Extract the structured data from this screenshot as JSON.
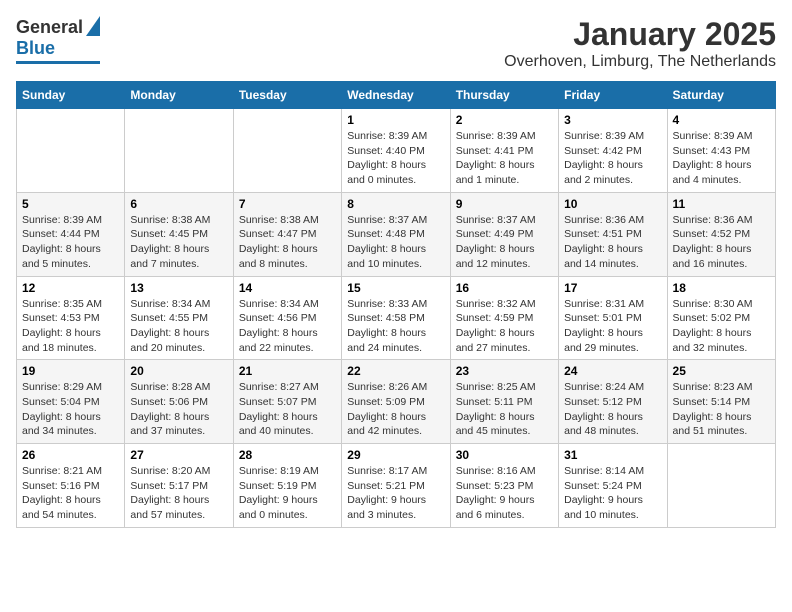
{
  "logo": {
    "general": "General",
    "blue": "Blue"
  },
  "title": "January 2025",
  "subtitle": "Overhoven, Limburg, The Netherlands",
  "days_of_week": [
    "Sunday",
    "Monday",
    "Tuesday",
    "Wednesday",
    "Thursday",
    "Friday",
    "Saturday"
  ],
  "weeks": [
    [
      {
        "day": "",
        "info": ""
      },
      {
        "day": "",
        "info": ""
      },
      {
        "day": "",
        "info": ""
      },
      {
        "day": "1",
        "info": "Sunrise: 8:39 AM\nSunset: 4:40 PM\nDaylight: 8 hours\nand 0 minutes."
      },
      {
        "day": "2",
        "info": "Sunrise: 8:39 AM\nSunset: 4:41 PM\nDaylight: 8 hours\nand 1 minute."
      },
      {
        "day": "3",
        "info": "Sunrise: 8:39 AM\nSunset: 4:42 PM\nDaylight: 8 hours\nand 2 minutes."
      },
      {
        "day": "4",
        "info": "Sunrise: 8:39 AM\nSunset: 4:43 PM\nDaylight: 8 hours\nand 4 minutes."
      }
    ],
    [
      {
        "day": "5",
        "info": "Sunrise: 8:39 AM\nSunset: 4:44 PM\nDaylight: 8 hours\nand 5 minutes."
      },
      {
        "day": "6",
        "info": "Sunrise: 8:38 AM\nSunset: 4:45 PM\nDaylight: 8 hours\nand 7 minutes."
      },
      {
        "day": "7",
        "info": "Sunrise: 8:38 AM\nSunset: 4:47 PM\nDaylight: 8 hours\nand 8 minutes."
      },
      {
        "day": "8",
        "info": "Sunrise: 8:37 AM\nSunset: 4:48 PM\nDaylight: 8 hours\nand 10 minutes."
      },
      {
        "day": "9",
        "info": "Sunrise: 8:37 AM\nSunset: 4:49 PM\nDaylight: 8 hours\nand 12 minutes."
      },
      {
        "day": "10",
        "info": "Sunrise: 8:36 AM\nSunset: 4:51 PM\nDaylight: 8 hours\nand 14 minutes."
      },
      {
        "day": "11",
        "info": "Sunrise: 8:36 AM\nSunset: 4:52 PM\nDaylight: 8 hours\nand 16 minutes."
      }
    ],
    [
      {
        "day": "12",
        "info": "Sunrise: 8:35 AM\nSunset: 4:53 PM\nDaylight: 8 hours\nand 18 minutes."
      },
      {
        "day": "13",
        "info": "Sunrise: 8:34 AM\nSunset: 4:55 PM\nDaylight: 8 hours\nand 20 minutes."
      },
      {
        "day": "14",
        "info": "Sunrise: 8:34 AM\nSunset: 4:56 PM\nDaylight: 8 hours\nand 22 minutes."
      },
      {
        "day": "15",
        "info": "Sunrise: 8:33 AM\nSunset: 4:58 PM\nDaylight: 8 hours\nand 24 minutes."
      },
      {
        "day": "16",
        "info": "Sunrise: 8:32 AM\nSunset: 4:59 PM\nDaylight: 8 hours\nand 27 minutes."
      },
      {
        "day": "17",
        "info": "Sunrise: 8:31 AM\nSunset: 5:01 PM\nDaylight: 8 hours\nand 29 minutes."
      },
      {
        "day": "18",
        "info": "Sunrise: 8:30 AM\nSunset: 5:02 PM\nDaylight: 8 hours\nand 32 minutes."
      }
    ],
    [
      {
        "day": "19",
        "info": "Sunrise: 8:29 AM\nSunset: 5:04 PM\nDaylight: 8 hours\nand 34 minutes."
      },
      {
        "day": "20",
        "info": "Sunrise: 8:28 AM\nSunset: 5:06 PM\nDaylight: 8 hours\nand 37 minutes."
      },
      {
        "day": "21",
        "info": "Sunrise: 8:27 AM\nSunset: 5:07 PM\nDaylight: 8 hours\nand 40 minutes."
      },
      {
        "day": "22",
        "info": "Sunrise: 8:26 AM\nSunset: 5:09 PM\nDaylight: 8 hours\nand 42 minutes."
      },
      {
        "day": "23",
        "info": "Sunrise: 8:25 AM\nSunset: 5:11 PM\nDaylight: 8 hours\nand 45 minutes."
      },
      {
        "day": "24",
        "info": "Sunrise: 8:24 AM\nSunset: 5:12 PM\nDaylight: 8 hours\nand 48 minutes."
      },
      {
        "day": "25",
        "info": "Sunrise: 8:23 AM\nSunset: 5:14 PM\nDaylight: 8 hours\nand 51 minutes."
      }
    ],
    [
      {
        "day": "26",
        "info": "Sunrise: 8:21 AM\nSunset: 5:16 PM\nDaylight: 8 hours\nand 54 minutes."
      },
      {
        "day": "27",
        "info": "Sunrise: 8:20 AM\nSunset: 5:17 PM\nDaylight: 8 hours\nand 57 minutes."
      },
      {
        "day": "28",
        "info": "Sunrise: 8:19 AM\nSunset: 5:19 PM\nDaylight: 9 hours\nand 0 minutes."
      },
      {
        "day": "29",
        "info": "Sunrise: 8:17 AM\nSunset: 5:21 PM\nDaylight: 9 hours\nand 3 minutes."
      },
      {
        "day": "30",
        "info": "Sunrise: 8:16 AM\nSunset: 5:23 PM\nDaylight: 9 hours\nand 6 minutes."
      },
      {
        "day": "31",
        "info": "Sunrise: 8:14 AM\nSunset: 5:24 PM\nDaylight: 9 hours\nand 10 minutes."
      },
      {
        "day": "",
        "info": ""
      }
    ]
  ]
}
